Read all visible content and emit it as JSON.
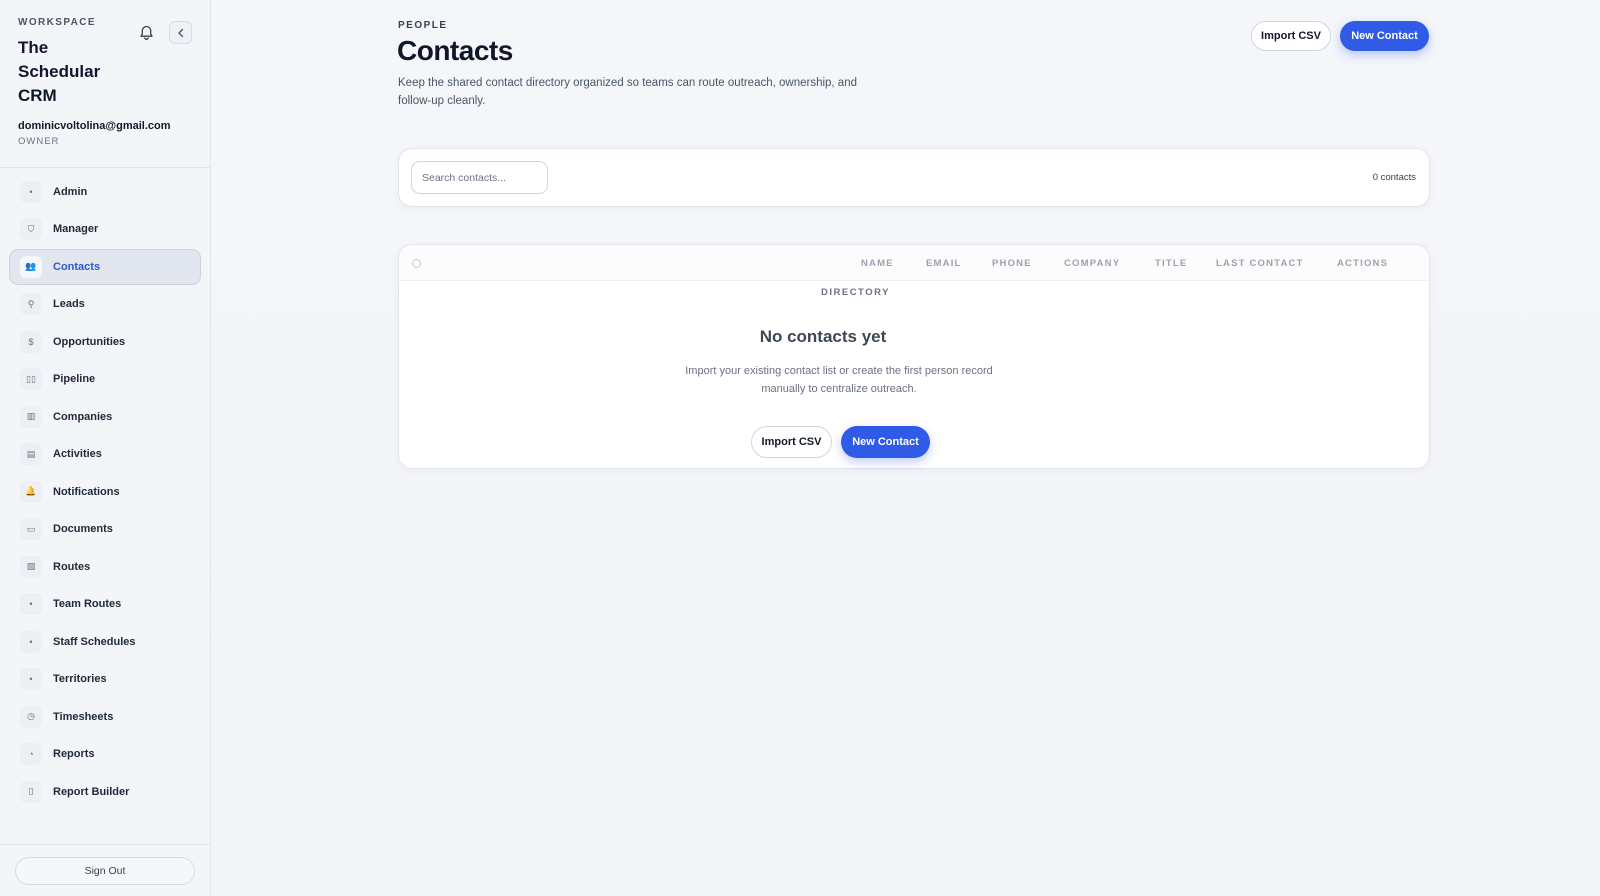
{
  "workspace": {
    "label": "WORKSPACE",
    "name": "The Schedular CRM",
    "email": "dominicvoltolina@gmail.com",
    "role": "OWNER"
  },
  "sidebar": {
    "items": [
      {
        "label": "Admin",
        "icon": "dot-icon",
        "glyph": "•"
      },
      {
        "label": "Manager",
        "icon": "shield-icon",
        "glyph": "⛉"
      },
      {
        "label": "Contacts",
        "icon": "users-icon",
        "glyph": "👥",
        "active": true
      },
      {
        "label": "Leads",
        "icon": "user-plus-icon",
        "glyph": "⚲"
      },
      {
        "label": "Opportunities",
        "icon": "dollar-icon",
        "glyph": "$"
      },
      {
        "label": "Pipeline",
        "icon": "columns-icon",
        "glyph": "▯▯"
      },
      {
        "label": "Companies",
        "icon": "building-icon",
        "glyph": "▥"
      },
      {
        "label": "Activities",
        "icon": "clipboard-icon",
        "glyph": "▤"
      },
      {
        "label": "Notifications",
        "icon": "bell-icon",
        "glyph": "🔔"
      },
      {
        "label": "Documents",
        "icon": "folder-icon",
        "glyph": "▭"
      },
      {
        "label": "Routes",
        "icon": "map-icon",
        "glyph": "▧"
      },
      {
        "label": "Team Routes",
        "icon": "dot-icon",
        "glyph": "•"
      },
      {
        "label": "Staff Schedules",
        "icon": "dot-icon",
        "glyph": "•"
      },
      {
        "label": "Territories",
        "icon": "dot-icon",
        "glyph": "•"
      },
      {
        "label": "Timesheets",
        "icon": "clock-icon",
        "glyph": "◷"
      },
      {
        "label": "Reports",
        "icon": "pie-chart-icon",
        "glyph": "◔"
      },
      {
        "label": "Report Builder",
        "icon": "file-icon",
        "glyph": "▯"
      }
    ],
    "sign_out": "Sign Out"
  },
  "header": {
    "eyebrow": "PEOPLE",
    "title": "Contacts",
    "description": "Keep the shared contact directory organized so teams can route outreach, ownership, and follow-up cleanly.",
    "import_label": "Import CSV",
    "new_label": "New Contact"
  },
  "search": {
    "placeholder": "Search contacts...",
    "value": "",
    "count": "0 contacts"
  },
  "table": {
    "columns": [
      "NAME",
      "EMAIL",
      "PHONE",
      "COMPANY",
      "TITLE",
      "LAST CONTACT",
      "ACTIONS"
    ]
  },
  "empty": {
    "eyebrow": "DIRECTORY",
    "title": "No contacts yet",
    "description": "Import your existing contact list or create the first person record manually to centralize outreach.",
    "import_label": "Import CSV",
    "new_label": "New Contact"
  },
  "colors": {
    "accent": "#2f5be6",
    "active_nav_text": "#2f55d4",
    "background": "#f3f5f9"
  }
}
